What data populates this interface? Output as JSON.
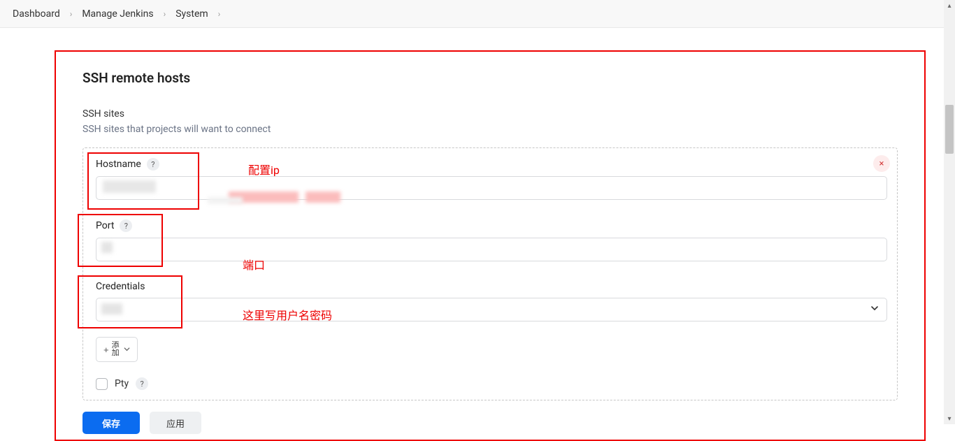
{
  "breadcrumb": {
    "items": [
      "Dashboard",
      "Manage Jenkins",
      "System"
    ]
  },
  "section": {
    "title": "SSH remote hosts",
    "subtitle": "SSH sites",
    "description": "SSH sites that projects will want to connect"
  },
  "fields": {
    "hostname_label": "Hostname",
    "hostname_value": "",
    "port_label": "Port",
    "port_value": "",
    "credentials_label": "Credentials",
    "credentials_value": "",
    "pty_label": "Pty",
    "help_symbol": "?",
    "add_label_line1": "添",
    "add_label_line2": "加"
  },
  "annotations": {
    "hostname_note": "配置ip",
    "port_note": "端口",
    "credentials_note": "这里写用户名密码"
  },
  "buttons": {
    "save": "保存",
    "apply": "应用",
    "close_symbol": "×",
    "plus_symbol": "+"
  }
}
